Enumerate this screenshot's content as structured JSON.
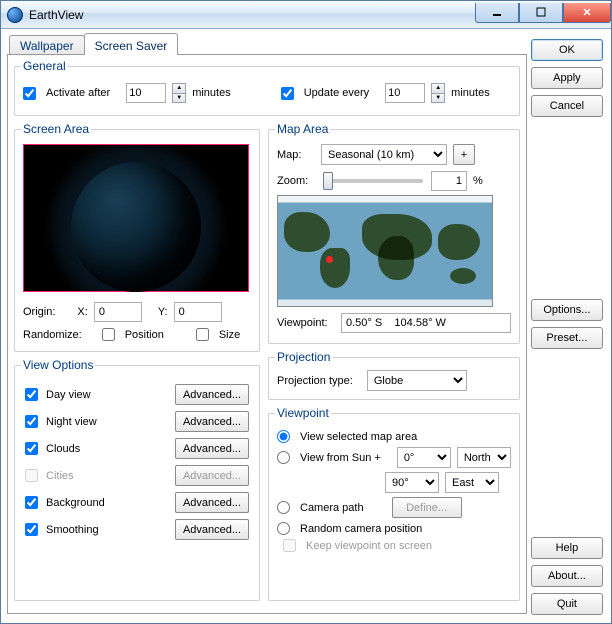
{
  "window": {
    "title": "EarthView"
  },
  "tabs": {
    "wallpaper": "Wallpaper",
    "screensaver": "Screen Saver",
    "active": "screensaver"
  },
  "buttons": {
    "ok": "OK",
    "apply": "Apply",
    "cancel": "Cancel",
    "options": "Options...",
    "preset": "Preset...",
    "help": "Help",
    "about": "About...",
    "quit": "Quit"
  },
  "general": {
    "legend": "General",
    "activate_label": "Activate after",
    "activate_checked": true,
    "activate_value": "10",
    "activate_unit": "minutes",
    "update_label": "Update every",
    "update_checked": true,
    "update_value": "10",
    "update_unit": "minutes"
  },
  "screen_area": {
    "legend": "Screen Area",
    "origin_label": "Origin:",
    "x_label": "X:",
    "x_value": "0",
    "y_label": "Y:",
    "y_value": "0",
    "randomize_label": "Randomize:",
    "position_label": "Position",
    "position_checked": false,
    "size_label": "Size",
    "size_checked": false
  },
  "view_options": {
    "legend": "View Options",
    "advanced": "Advanced...",
    "items": [
      {
        "label": "Day view",
        "checked": true,
        "enabled": true
      },
      {
        "label": "Night view",
        "checked": true,
        "enabled": true
      },
      {
        "label": "Clouds",
        "checked": true,
        "enabled": true
      },
      {
        "label": "Cities",
        "checked": false,
        "enabled": false
      },
      {
        "label": "Background",
        "checked": true,
        "enabled": true
      },
      {
        "label": "Smoothing",
        "checked": true,
        "enabled": true
      }
    ]
  },
  "map_area": {
    "legend": "Map Area",
    "map_label": "Map:",
    "map_value": "Seasonal (10 km)",
    "plus": "+",
    "zoom_label": "Zoom:",
    "zoom_value": "1",
    "zoom_unit": "%",
    "viewpoint_label": "Viewpoint:",
    "viewpoint_value": "0.50° S    104.58° W"
  },
  "projection": {
    "legend": "Projection",
    "type_label": "Projection type:",
    "type_value": "Globe"
  },
  "viewpoint": {
    "legend": "Viewpoint",
    "view_selected": "View selected map area",
    "view_from_sun": "View from Sun +",
    "angle1": "0°",
    "dir1": "North",
    "angle2": "90°",
    "dir2": "East",
    "camera_path": "Camera path",
    "define": "Define...",
    "random": "Random camera position",
    "keep_label": "Keep viewpoint on screen",
    "selected": "view_selected"
  }
}
